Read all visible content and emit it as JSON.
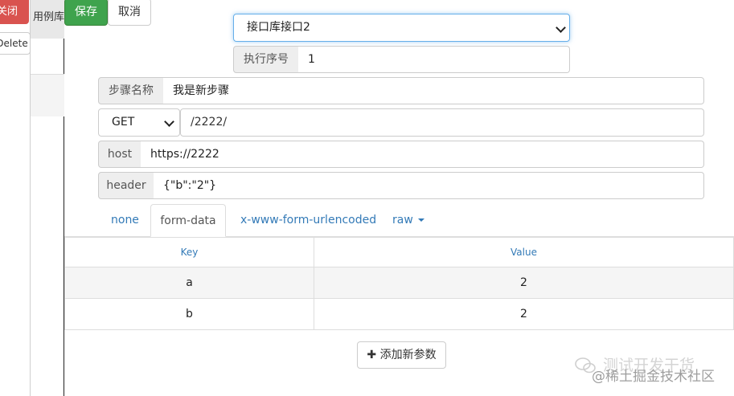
{
  "background": {
    "close_label": "关闭",
    "delete_label": "Delete",
    "tab_label": "用例库"
  },
  "toolbar": {
    "save_label": "保存",
    "cancel_label": "取消"
  },
  "api_select": {
    "value": "接口库接口2"
  },
  "exec_order": {
    "label": "执行序号",
    "value": "1"
  },
  "step_name": {
    "label": "步骤名称",
    "value": "我是新步骤"
  },
  "request": {
    "method": "GET",
    "url": "/2222/"
  },
  "host": {
    "label": "host",
    "value": "https://2222"
  },
  "header": {
    "label": "header",
    "value": "{\"b\":\"2\"}"
  },
  "body_tabs": [
    {
      "label": "none",
      "active": false
    },
    {
      "label": "form-data",
      "active": true
    },
    {
      "label": "x-www-form-urlencoded",
      "active": false
    },
    {
      "label": "raw",
      "active": false
    }
  ],
  "params_table": {
    "columns": [
      "Key",
      "Value"
    ],
    "rows": [
      {
        "key": "a",
        "value": "2"
      },
      {
        "key": "b",
        "value": "2"
      }
    ]
  },
  "add_param_label": "添加新参数",
  "watermark": {
    "line1": "测试开发干货",
    "line2": "@稀土掘金技术社区"
  },
  "colors": {
    "save": "#3fa34d",
    "close": "#d9534f",
    "link": "#337ab7",
    "addon_bg": "#eeeeee"
  }
}
